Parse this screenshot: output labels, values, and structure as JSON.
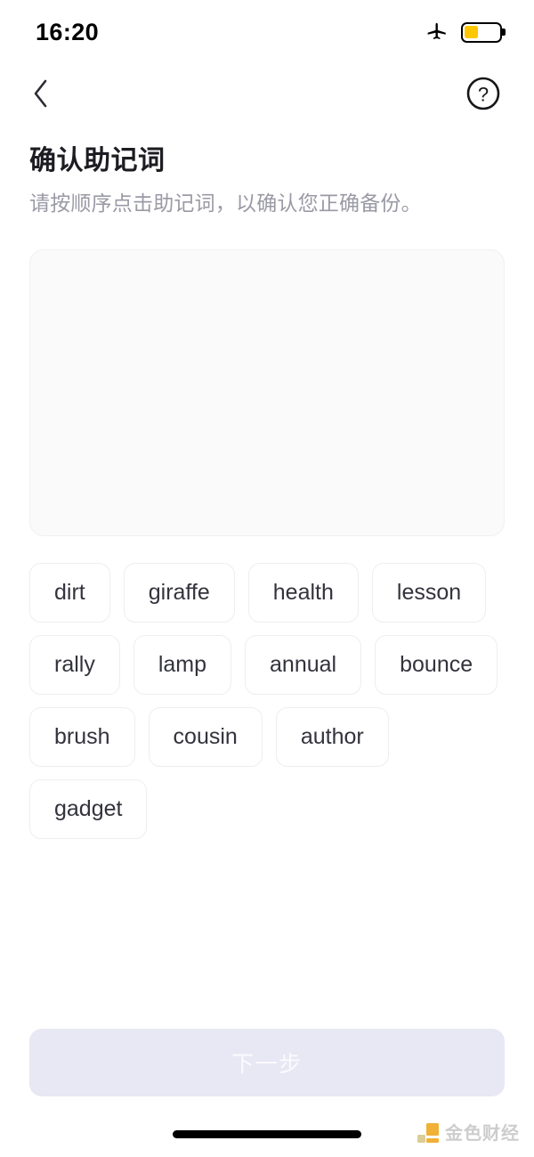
{
  "status_bar": {
    "time": "16:20",
    "airplane_icon": "airplane-mode-icon",
    "battery_icon": "battery-low-power-icon",
    "battery_level_percent": 40,
    "battery_color": "#ffc700"
  },
  "nav": {
    "back_icon": "chevron-left-icon",
    "help_icon": "question-mark-circle-icon"
  },
  "header": {
    "title": "确认助记词",
    "subtitle": "请按顺序点击助记词，以确认您正确备份。"
  },
  "answer_area": {
    "selected_words": [],
    "placeholder": ""
  },
  "word_bank": {
    "words": [
      "dirt",
      "giraffe",
      "health",
      "lesson",
      "rally",
      "lamp",
      "annual",
      "bounce",
      "brush",
      "cousin",
      "author",
      "gadget"
    ]
  },
  "footer": {
    "next_label": "下一步",
    "next_enabled": false,
    "next_bg_color": "#e8e7f4",
    "next_text_color": "#fbfbfe"
  },
  "watermark": {
    "text": "金色财经",
    "logo_color": "#efab26"
  }
}
